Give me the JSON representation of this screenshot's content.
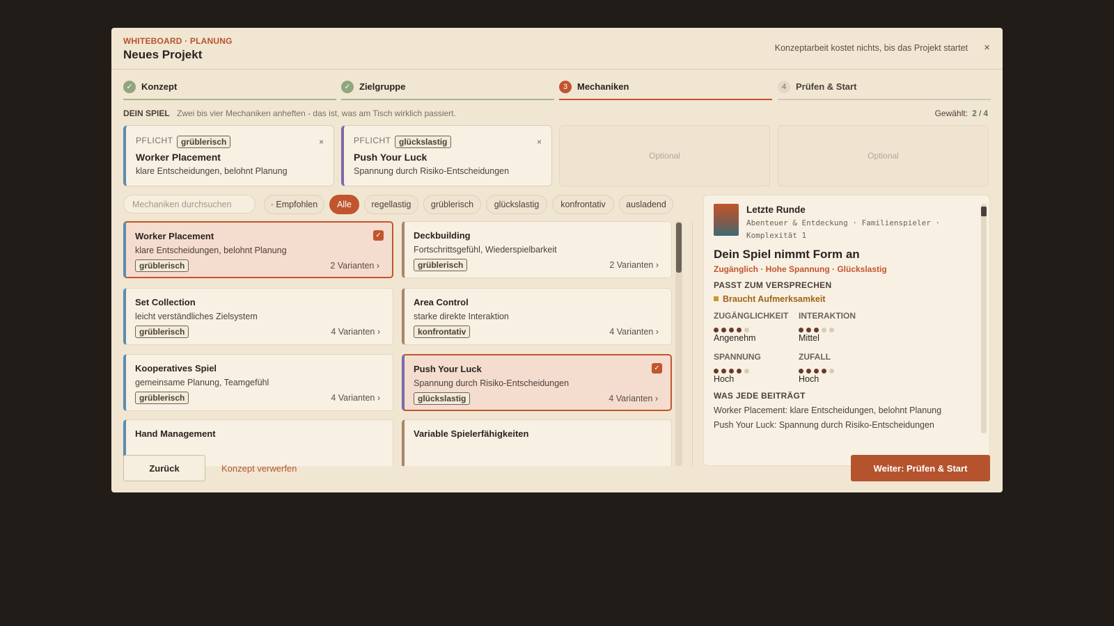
{
  "header": {
    "eyebrow": "WHITEBOARD · PLANUNG",
    "title": "Neues Projekt",
    "note": "Konzeptarbeit kostet nichts, bis das Projekt startet",
    "close": "×"
  },
  "steps": [
    {
      "marker": "✓",
      "label": "Konzept",
      "state": "done"
    },
    {
      "marker": "✓",
      "label": "Zielgruppe",
      "state": "done"
    },
    {
      "marker": "3",
      "label": "Mechaniken",
      "state": "active"
    },
    {
      "marker": "4",
      "label": "Prüfen & Start",
      "state": "pending"
    }
  ],
  "spiel": {
    "label": "DEIN SPIEL",
    "hint": "Zwei bis vier Mechaniken anheften - das ist, was am Tisch wirklich passiert.",
    "selected_label": "Gewählt:",
    "selected_count": "2",
    "separator": "/",
    "max_count": "4"
  },
  "slots": [
    {
      "tag": "PFLICHT",
      "chip": "grüblerisch",
      "name": "Worker Placement",
      "desc": "klare Entscheidungen, belohnt Planung",
      "remove": "×"
    },
    {
      "tag": "PFLICHT",
      "chip": "glückslastig",
      "name": "Push Your Luck",
      "desc": "Spannung durch Risiko-Entscheidungen",
      "remove": "×"
    },
    {
      "optional": "Optional"
    },
    {
      "optional": "Optional"
    }
  ],
  "search": {
    "placeholder": "Mechaniken durchsuchen"
  },
  "filters": [
    "· Empfohlen",
    "Alle",
    "regellastig",
    "grüblerisch",
    "glückslastig",
    "konfrontativ",
    "ausladend"
  ],
  "active_filter": "Alle",
  "mechanics": [
    {
      "name": "Worker Placement",
      "desc": "klare Entscheidungen, belohnt Planung",
      "chip": "grüblerisch",
      "variants": "2 Varianten ›",
      "selected": true,
      "check": "✓"
    },
    {
      "name": "Deckbuilding",
      "desc": "Fortschrittsgefühl, Wiederspielbarkeit",
      "chip": "grüblerisch",
      "variants": "2 Varianten ›",
      "selected": false
    },
    {
      "name": "Set Collection",
      "desc": "leicht verständliches Zielsystem",
      "chip": "grüblerisch",
      "variants": "4 Varianten ›",
      "selected": false
    },
    {
      "name": "Area Control",
      "desc": "starke direkte Interaktion",
      "chip": "konfrontativ",
      "variants": "4 Varianten ›",
      "selected": false
    },
    {
      "name": "Kooperatives Spiel",
      "desc": "gemeinsame Planung, Teamgefühl",
      "chip": "grüblerisch",
      "variants": "4 Varianten ›",
      "selected": false
    },
    {
      "name": "Push Your Luck",
      "desc": "Spannung durch Risiko-Entscheidungen",
      "chip": "glückslastig",
      "variants": "4 Varianten ›",
      "selected": true,
      "check": "✓"
    },
    {
      "name": "Hand Management"
    },
    {
      "name": "Variable Spielerfähigkeiten"
    }
  ],
  "preview": {
    "name": "Letzte Runde",
    "meta": "Abenteuer & Entdeckung · Familienspieler · Komplexität 1",
    "headline": "Dein Spiel nimmt Form an",
    "tags": "Zugänglich · Hohe Spannung · Glückslastig",
    "fit_label": "PASST ZUM VERSPRECHEN",
    "fit_warning": "Braucht Aufmerksamkeit",
    "metrics": [
      {
        "label": "ZUGÄNGLICHKEIT",
        "value": "Angenehm",
        "level": 4,
        "max": 5
      },
      {
        "label": "INTERAKTION",
        "value": "Mittel",
        "level": 3,
        "max": 5
      },
      {
        "label": "SPANNUNG",
        "value": "Hoch",
        "level": 4,
        "max": 5
      },
      {
        "label": "ZUFALL",
        "value": "Hoch",
        "level": 4,
        "max": 5
      }
    ],
    "contrib_label": "WAS JEDE BEITRÄGT",
    "contributions": [
      "Worker Placement: klare Entscheidungen, belohnt Planung",
      "Push Your Luck: Spannung durch Risiko-Entscheidungen"
    ]
  },
  "footer": {
    "back": "Zurück",
    "discard": "Konzept verwerfen",
    "next": "Weiter: Prüfen & Start"
  },
  "colors": {
    "accent": "#c0552e",
    "done": "#8fa77c",
    "background": "#221c19",
    "panel": "#f1e6d2"
  }
}
